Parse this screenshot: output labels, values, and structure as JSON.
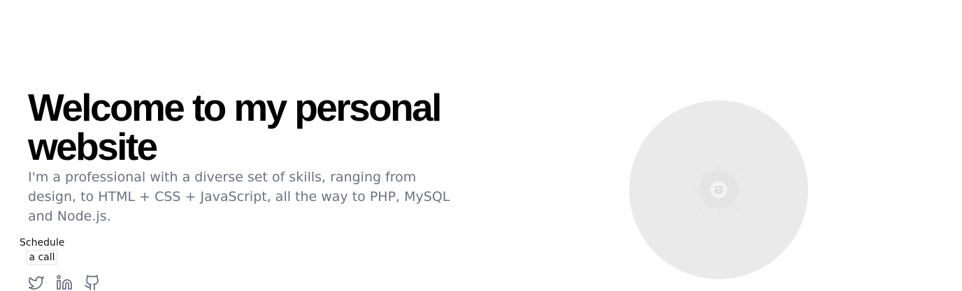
{
  "hero": {
    "title": "Welcome to my personal website",
    "subtitle": "I'm a professional with a diverse set of skills, ranging from design, to HTML + CSS + JavaScript, all the way to PHP, MySQL and Node.js."
  },
  "cta": {
    "line1": "Schedule",
    "line2": "a call"
  },
  "socials": [
    {
      "icon": "twitter-icon"
    },
    {
      "icon": "linkedin-icon"
    },
    {
      "icon": "github-icon"
    }
  ],
  "avatar": {
    "icon": "image-placeholder-icon"
  },
  "colors": {
    "heading": "#000000",
    "body_text": "#6b7280",
    "avatar_bg": "#eaeaea"
  }
}
